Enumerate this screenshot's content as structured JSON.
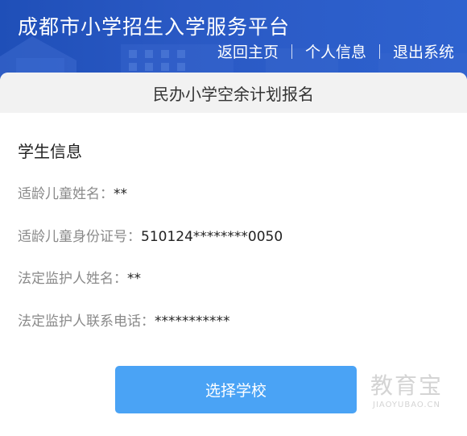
{
  "header": {
    "site_title": "成都市小学招生入学服务平台",
    "nav": {
      "home": "返回主页",
      "profile": "个人信息",
      "logout": "退出系统"
    }
  },
  "card": {
    "title": "民办小学空余计划报名"
  },
  "student_info": {
    "section_title": "学生信息",
    "fields": [
      {
        "label": "适龄儿童姓名：",
        "value": "**"
      },
      {
        "label": "适龄儿童身份证号：",
        "value": "510124********0050"
      },
      {
        "label": "法定监护人姓名：",
        "value": "**"
      },
      {
        "label": "法定监护人联系电话：",
        "value": "***********"
      }
    ]
  },
  "actions": {
    "select_school": "选择学校"
  },
  "watermark": {
    "cn": "教育宝",
    "en": "JIAOYUBAO.CN"
  },
  "colors": {
    "header_blue": "#2a59c4",
    "button_blue": "#4aa3f5"
  }
}
